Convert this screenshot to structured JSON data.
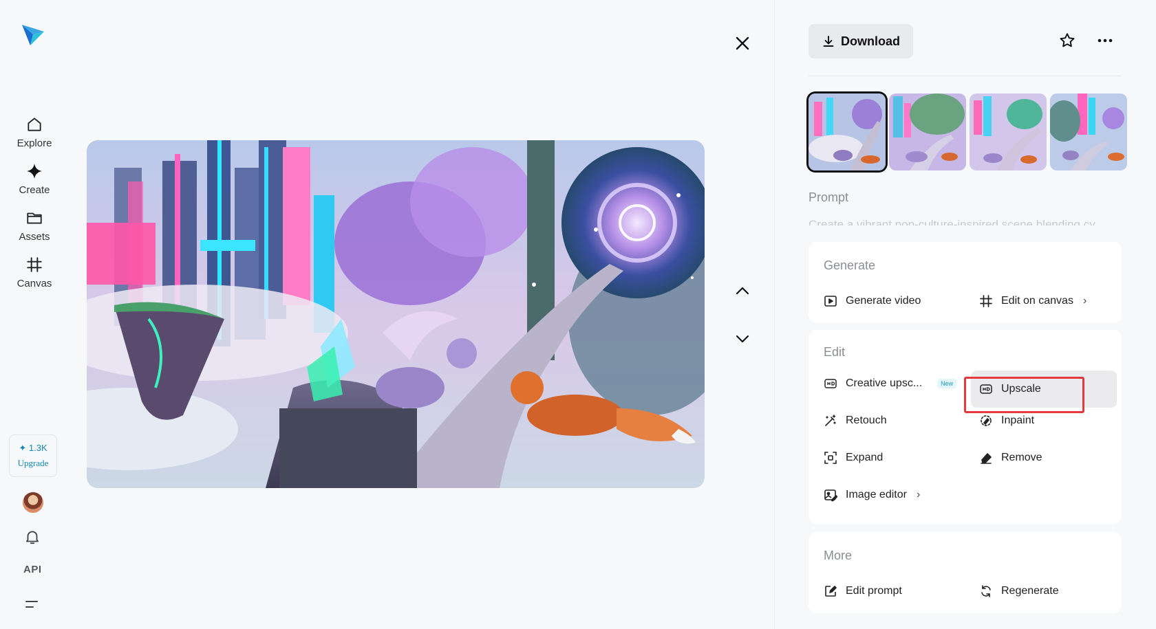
{
  "sidebar": {
    "items": [
      {
        "label": "Explore",
        "icon": "home-icon"
      },
      {
        "label": "Create",
        "icon": "sparkle-icon"
      },
      {
        "label": "Assets",
        "icon": "folder-icon"
      },
      {
        "label": "Canvas",
        "icon": "canvas-icon"
      }
    ],
    "credits": "✦ 1.3K",
    "upgrade": "Upgrade",
    "api": "API"
  },
  "toolbar": {
    "download": "Download"
  },
  "prompt": {
    "label": "Prompt",
    "text": "Create a vibrant pop-culture-inspired scene blending cy"
  },
  "generate": {
    "title": "Generate",
    "video": "Generate video",
    "canvas": "Edit on canvas",
    "canvas_chevron": "›"
  },
  "edit": {
    "title": "Edit",
    "creative_upscale": "Creative upsc...",
    "new_badge": "New",
    "upscale": "Upscale",
    "retouch": "Retouch",
    "inpaint": "Inpaint",
    "expand": "Expand",
    "remove": "Remove",
    "image_editor": "Image editor",
    "image_editor_chevron": "›"
  },
  "more": {
    "title": "More",
    "edit_prompt": "Edit prompt",
    "regenerate": "Regenerate"
  },
  "colors": {
    "accent": "#1587b4",
    "highlight": "#e5393f",
    "panel_bg": "#ffffff",
    "page_bg": "#f7f8fa"
  }
}
